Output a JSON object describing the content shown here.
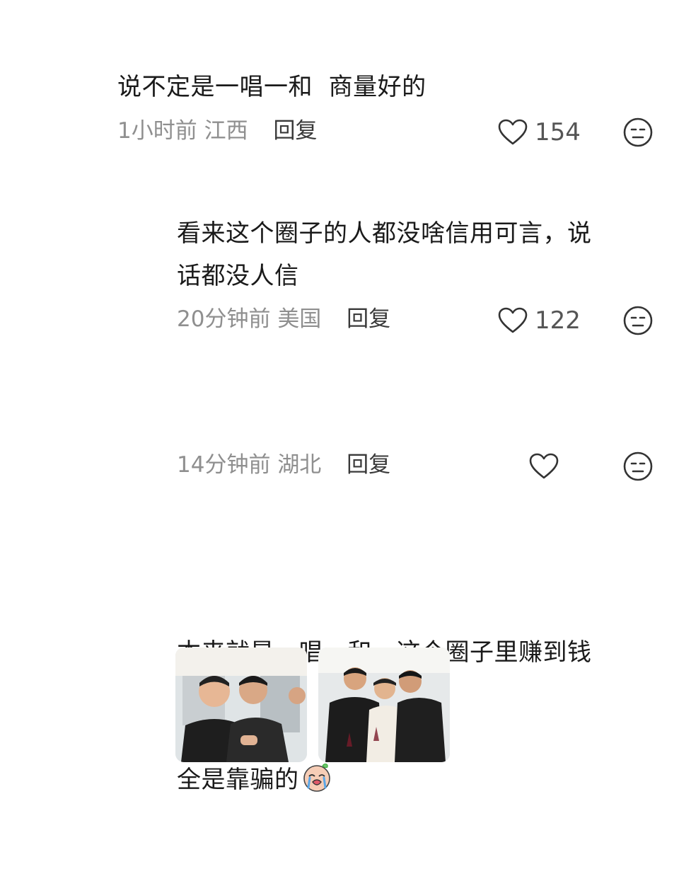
{
  "comments": [
    {
      "text": "说不定是一唱一和  商量好的",
      "time": "1小时前",
      "location": "江西",
      "reply_label": "回复",
      "likes": "154"
    },
    {
      "text": "看来这个圈子的人都没啥信用可言，说\n话都没人信",
      "time": "20分钟前",
      "location": "美国",
      "reply_label": "回复",
      "likes": "122"
    },
    {
      "text": "",
      "time": "14分钟前",
      "location": "湖北",
      "reply_label": "回复",
      "likes": ""
    },
    {
      "text_line1": "本来就是一唱一和，这个圈子里赚到钱",
      "text_line2": "全是靠骗的",
      "inline_emoji": "crying-face-icon"
    }
  ],
  "icons": {
    "like": "heart-outline-icon",
    "dislike": "neutral-face-icon"
  },
  "colors": {
    "meta_text": "#8f8f8f",
    "body_text": "#1a1a1a",
    "icon_stroke": "#333333"
  }
}
